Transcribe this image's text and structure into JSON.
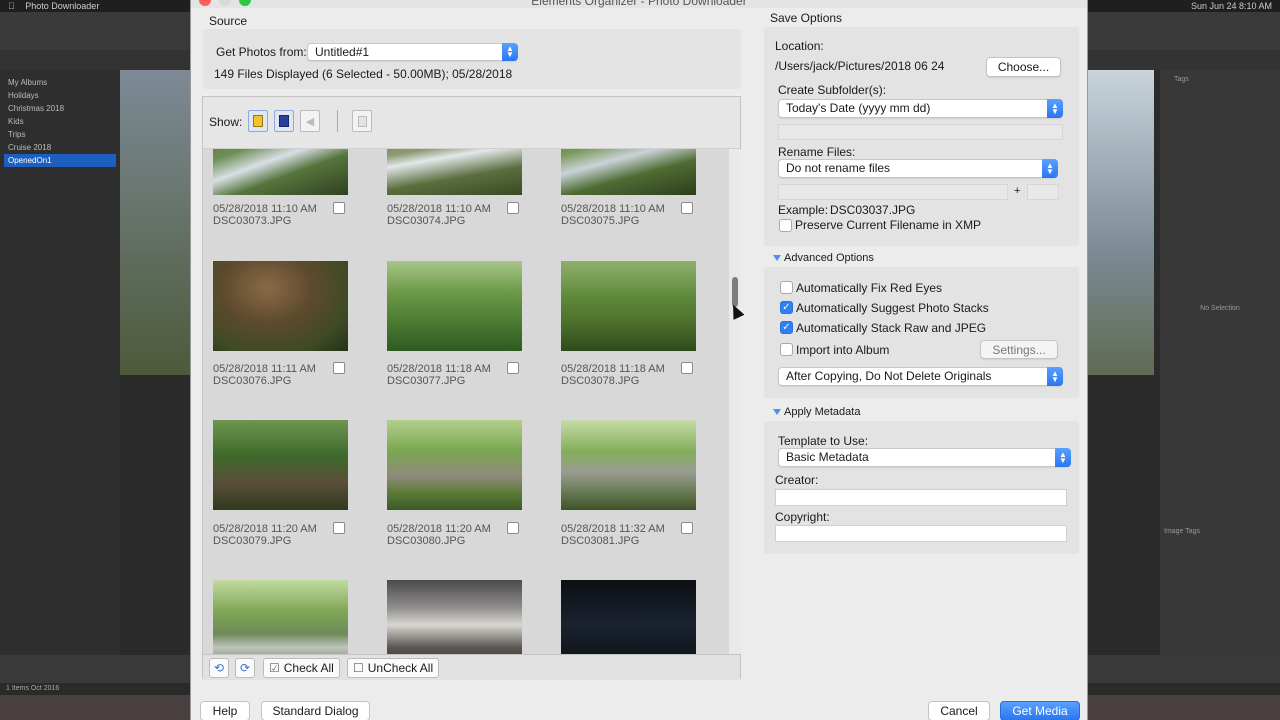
{
  "background": {
    "menubar_app": "Photo Downloader",
    "menubar_right": "Sun Jun 24  8:10 AM",
    "sidebar": [
      "My Albums",
      "Holidays",
      "Christmas 2018",
      "Kids",
      "Trips",
      "Cruise 2018",
      "Cruise 2018",
      "OpenedOn1"
    ],
    "info_no_selection": "No Selection",
    "info_tags": "Tags",
    "info_image_tags": "Image Tags",
    "status": "1 Items   Oct 2016"
  },
  "dialog": {
    "title": "Elements Organizer - Photo Downloader",
    "source": {
      "section_label": "Source",
      "get_photos_from_label": "Get Photos from:",
      "get_photos_from_value": "Untitled#1",
      "files_info": "149 Files Displayed (6 Selected - 50.00MB); 05/28/2018"
    },
    "show_label": "Show:",
    "thumbnails": [
      {
        "date": "05/28/2018 11:10 AM",
        "file": "DSC03073.JPG"
      },
      {
        "date": "05/28/2018 11:10 AM",
        "file": "DSC03074.JPG"
      },
      {
        "date": "05/28/2018 11:10 AM",
        "file": "DSC03075.JPG"
      },
      {
        "date": "05/28/2018 11:11 AM",
        "file": "DSC03076.JPG"
      },
      {
        "date": "05/28/2018 11:18 AM",
        "file": "DSC03077.JPG"
      },
      {
        "date": "05/28/2018 11:18 AM",
        "file": "DSC03078.JPG"
      },
      {
        "date": "05/28/2018 11:20 AM",
        "file": "DSC03079.JPG"
      },
      {
        "date": "05/28/2018 11:20 AM",
        "file": "DSC03080.JPG"
      },
      {
        "date": "05/28/2018 11:32 AM",
        "file": "DSC03081.JPG"
      },
      {
        "date": "",
        "file": ""
      },
      {
        "date": "",
        "file": ""
      },
      {
        "date": "",
        "file": ""
      }
    ],
    "footer": {
      "check_all": "Check All",
      "uncheck_all": "UnCheck All"
    },
    "save_options": {
      "section_label": "Save Options",
      "location_label": "Location:",
      "location_value": "/Users/jack/Pictures/2018 06 24",
      "choose_button": "Choose...",
      "subfolder_label": "Create Subfolder(s):",
      "subfolder_value": "Today's Date (yyyy mm dd)",
      "rename_label": "Rename Files:",
      "rename_value": "Do not rename files",
      "plus": "+",
      "example_label": "Example:",
      "example_value": "DSC03037.JPG",
      "preserve_label": "Preserve Current Filename in XMP"
    },
    "advanced": {
      "header": "Advanced Options",
      "fix_red_eyes": "Automatically Fix Red Eyes",
      "suggest_stacks": "Automatically Suggest Photo Stacks",
      "stack_raw": "Automatically Stack Raw and JPEG",
      "import_album": "Import into Album",
      "settings_button": "Settings...",
      "after_copying_value": "After Copying, Do Not Delete Originals"
    },
    "metadata": {
      "header": "Apply Metadata",
      "template_label": "Template to Use:",
      "template_value": "Basic Metadata",
      "creator_label": "Creator:",
      "copyright_label": "Copyright:"
    },
    "buttons": {
      "help": "Help",
      "standard_dialog": "Standard Dialog",
      "cancel": "Cancel",
      "get_media": "Get Media"
    }
  }
}
